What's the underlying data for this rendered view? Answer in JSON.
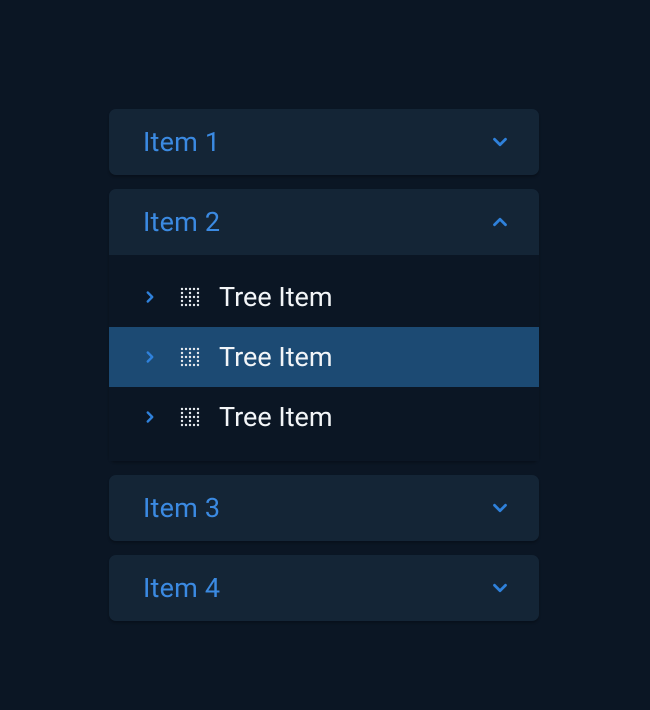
{
  "colors": {
    "background": "#0b1624",
    "panel": "#142536",
    "accent": "#3b8ae2",
    "selection": "#1c4a73",
    "text": "#f2f5f8"
  },
  "accordion": {
    "sections": [
      {
        "id": "item-1",
        "label": "Item 1",
        "expanded": false
      },
      {
        "id": "item-2",
        "label": "Item 2",
        "expanded": true,
        "tree": [
          {
            "label": "Tree Item",
            "selected": false
          },
          {
            "label": "Tree Item",
            "selected": true
          },
          {
            "label": "Tree Item",
            "selected": false
          }
        ]
      },
      {
        "id": "item-3",
        "label": "Item 3",
        "expanded": false
      },
      {
        "id": "item-4",
        "label": "Item 4",
        "expanded": false
      }
    ]
  }
}
